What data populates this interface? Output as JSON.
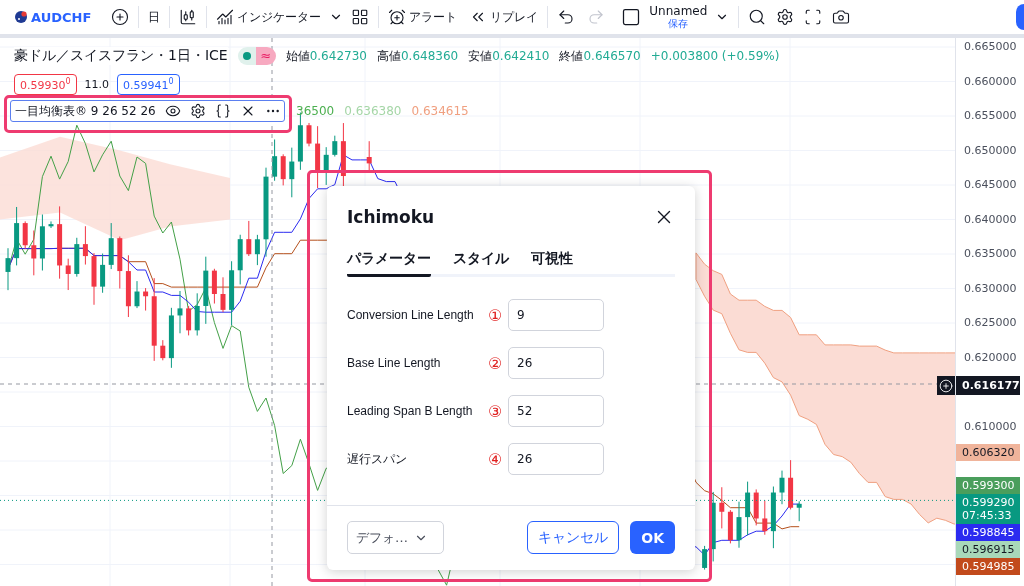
{
  "toolbar": {
    "symbol": "AUDCHF",
    "interval": "日",
    "indicators_label": "インジケーター",
    "alert_label": "アラート",
    "replay_label": "リプレイ",
    "layout_name": "Unnamed",
    "layout_status": "保存"
  },
  "legend": {
    "title": "豪ドル／スイスフラン・1日・ICE",
    "status_glyph": "≈",
    "ohlc": [
      {
        "label": "始値",
        "value": "0.642730"
      },
      {
        "label": "高値",
        "value": "0.648360"
      },
      {
        "label": "安値",
        "value": "0.642410"
      },
      {
        "label": "終値",
        "value": "0.646570"
      }
    ],
    "change": "+0.003800 (+0.59%)",
    "sell_price": "0.59930$^{0}$",
    "spread": "11.0",
    "buy_price": "0.59941$^{0}$"
  },
  "indicator": {
    "name": "一目均衡表®",
    "params": "9 26 52 26",
    "values": [
      {
        "text": "36500",
        "color": "#4caf50"
      },
      {
        "text": "0.636380",
        "color": "#a5d6a7"
      },
      {
        "text": "0.634615",
        "color": "#f0a080"
      }
    ]
  },
  "price_axis": {
    "labels": [
      "0.665000",
      "0.660000",
      "0.655000",
      "0.650000",
      "0.645000",
      "0.640000",
      "0.635000",
      "0.630000",
      "0.625000",
      "0.620000",
      "0.610000"
    ],
    "crosshair_price": "0.616177",
    "cloud_price": "0.606320",
    "badges": [
      {
        "text": "0.599300",
        "color": "#4a9e5c"
      },
      {
        "text": "0.599290",
        "time": "07:45:33",
        "color": "#089981"
      },
      {
        "text": "0.598845",
        "color": "#2b2bf0"
      },
      {
        "text": "0.596915",
        "color": "#a8d8b9"
      },
      {
        "text": "0.594985",
        "color": "#c24a1c"
      }
    ]
  },
  "dialog": {
    "title": "Ichimoku",
    "tabs": [
      {
        "label": "パラメーター",
        "selected": true
      },
      {
        "label": "スタイル",
        "selected": false
      },
      {
        "label": "可視性",
        "selected": false
      }
    ],
    "fields": [
      {
        "label": "Conversion Line Length",
        "marker": "①",
        "value": "9"
      },
      {
        "label": "Base Line Length",
        "marker": "②",
        "value": "26"
      },
      {
        "label": "Leading Span B Length",
        "marker": "③",
        "value": "52"
      },
      {
        "label": "遅行スパン",
        "marker": "④",
        "value": "26"
      }
    ],
    "defaults": "デフォ…",
    "cancel": "キャンセル",
    "ok": "OK"
  }
}
